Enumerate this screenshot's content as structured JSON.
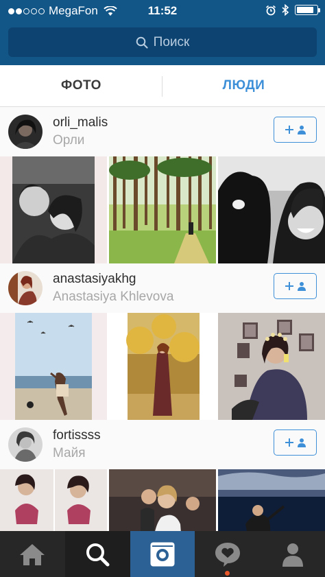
{
  "status_bar": {
    "carrier": "MegaFon",
    "time": "11:52",
    "battery_fraction": 0.85
  },
  "search": {
    "placeholder": "Поиск"
  },
  "tabs": [
    {
      "label": "ФОТО",
      "active": false
    },
    {
      "label": "ЛЮДИ",
      "active": true
    }
  ],
  "users": [
    {
      "username": "orli_malis",
      "full_name": "Орли"
    },
    {
      "username": "anastasiyakhg",
      "full_name": "Anastasiya Khlevova"
    },
    {
      "username": "fortissss",
      "full_name": "Майя"
    }
  ],
  "colors": {
    "header": "#125688",
    "accent": "#3d8fd8",
    "tab_bar": "#272727",
    "camera_tab": "#2c6196",
    "notification": "#e8572a"
  },
  "tab_bar": {
    "items": [
      "home-icon",
      "search-icon",
      "camera-icon",
      "activity-icon",
      "profile-icon"
    ],
    "selected": "search-icon"
  }
}
